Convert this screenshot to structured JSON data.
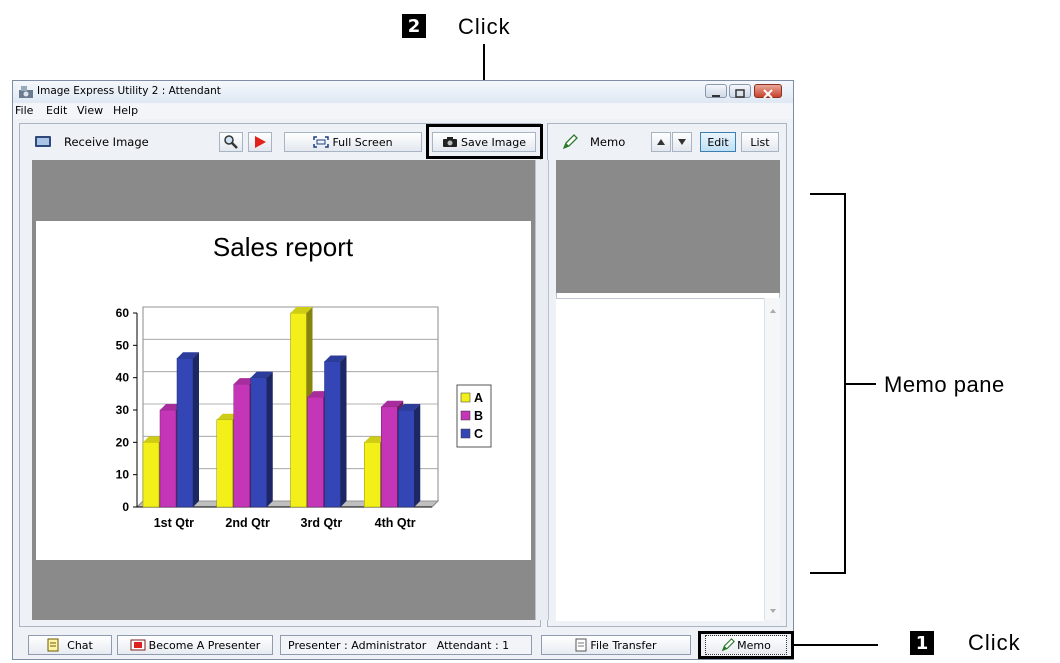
{
  "window": {
    "title": "Image Express Utility 2 : Attendant",
    "menu": [
      "File",
      "Edit",
      "View",
      "Help"
    ]
  },
  "toolbar": {
    "receive_label": "Receive Image",
    "full_screen_label": "Full Screen",
    "save_image_label": "Save Image"
  },
  "memo": {
    "label": "Memo",
    "edit_label": "Edit",
    "list_label": "List"
  },
  "status": {
    "chat_label": "Chat",
    "presenter_button_label": "Become A Presenter",
    "info": "Presenter : Administrator   Attendant : 1",
    "file_transfer_label": "File Transfer",
    "memo_button_label": "Memo"
  },
  "annotations": {
    "step1_num": "1",
    "step1_text": "Click",
    "step2_num": "2",
    "step2_text": "Click",
    "memo_pane_text": "Memo pane"
  },
  "colors": {
    "series_a": "#f3f019",
    "series_b": "#c435b8",
    "series_c": "#3446b6"
  },
  "chart_data": {
    "type": "bar",
    "title": "Sales report",
    "categories": [
      "1st Qtr",
      "2nd Qtr",
      "3rd Qtr",
      "4th Qtr"
    ],
    "series": [
      {
        "name": "A",
        "values": [
          20,
          27,
          60,
          20
        ]
      },
      {
        "name": "B",
        "values": [
          30,
          38,
          34,
          31
        ]
      },
      {
        "name": "C",
        "values": [
          46,
          40,
          45,
          30
        ]
      }
    ],
    "yticks": [
      "0",
      "10",
      "20",
      "30",
      "40",
      "50",
      "60"
    ],
    "ylim": [
      0,
      60
    ],
    "legend": "right"
  }
}
